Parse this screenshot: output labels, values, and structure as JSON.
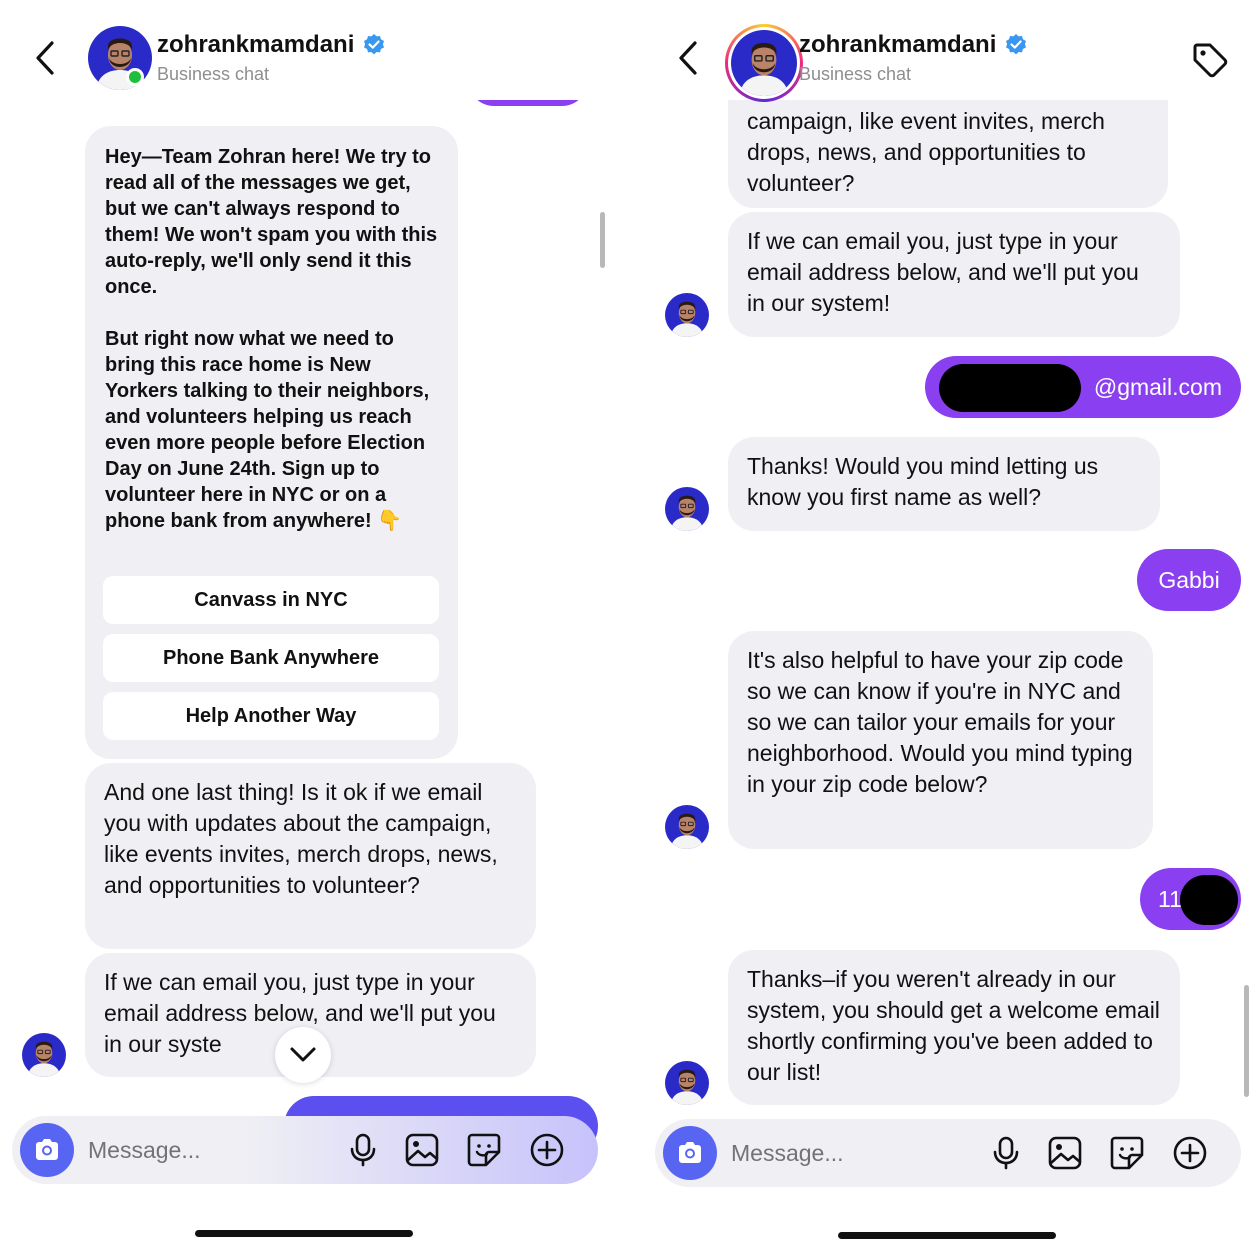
{
  "left": {
    "header": {
      "username": "zohrankmamdani",
      "subtitle": "Business chat"
    },
    "messages": {
      "auto_reply": "Hey—Team Zohran here! We try to read all of the messages we get, but we can't always respond to them! We won't spam you with this auto-reply, we'll only send it this once.\n\nBut right now what we need to bring this race home is New Yorkers talking to their neighbors, and volunteers helping us reach even more people before Election Day on June 24th. Sign up to volunteer here in NYC or on a phone bank from anywhere! 👇",
      "quick_replies": [
        "Canvass in NYC",
        "Phone Bank Anywhere",
        "Help Another Way"
      ],
      "email_ask": "And one last thing! Is it ok if we email you with updates about the campaign, like events invites, merch drops, news, and opportunities to volunteer?",
      "email_instructions": "If we can email you, just type in your email address below, and we'll put you in our syste"
    },
    "composer": {
      "placeholder": "Message..."
    }
  },
  "right": {
    "header": {
      "username": "zohrankmamdani",
      "subtitle": "Business chat"
    },
    "messages": {
      "email_ask_tail": "campaign, like event invites, merch drops, news, and opportunities to volunteer?",
      "email_instructions": "If we can email you, just type in your email address below, and we'll put you in our system!",
      "sent_email_suffix": "@gmail.com",
      "name_ask": "Thanks! Would you mind letting us know you first name as well?",
      "sent_name": "Gabbi",
      "zip_ask": "It's also helpful to have your zip code so we can know if you're in NYC and so we can tailor your emails for your neighborhood. Would you mind typing in your zip code below?",
      "sent_zip_prefix": "11",
      "confirmation": "Thanks–if you weren't already in our system, you should get a welcome email shortly confirming you've been added to our list!"
    },
    "composer": {
      "placeholder": "Message..."
    }
  },
  "colors": {
    "sent_bubble": "#8a3ff0",
    "received_bubble": "#efeff4",
    "camera_button": "#5865f2",
    "verified": "#3897f0"
  }
}
